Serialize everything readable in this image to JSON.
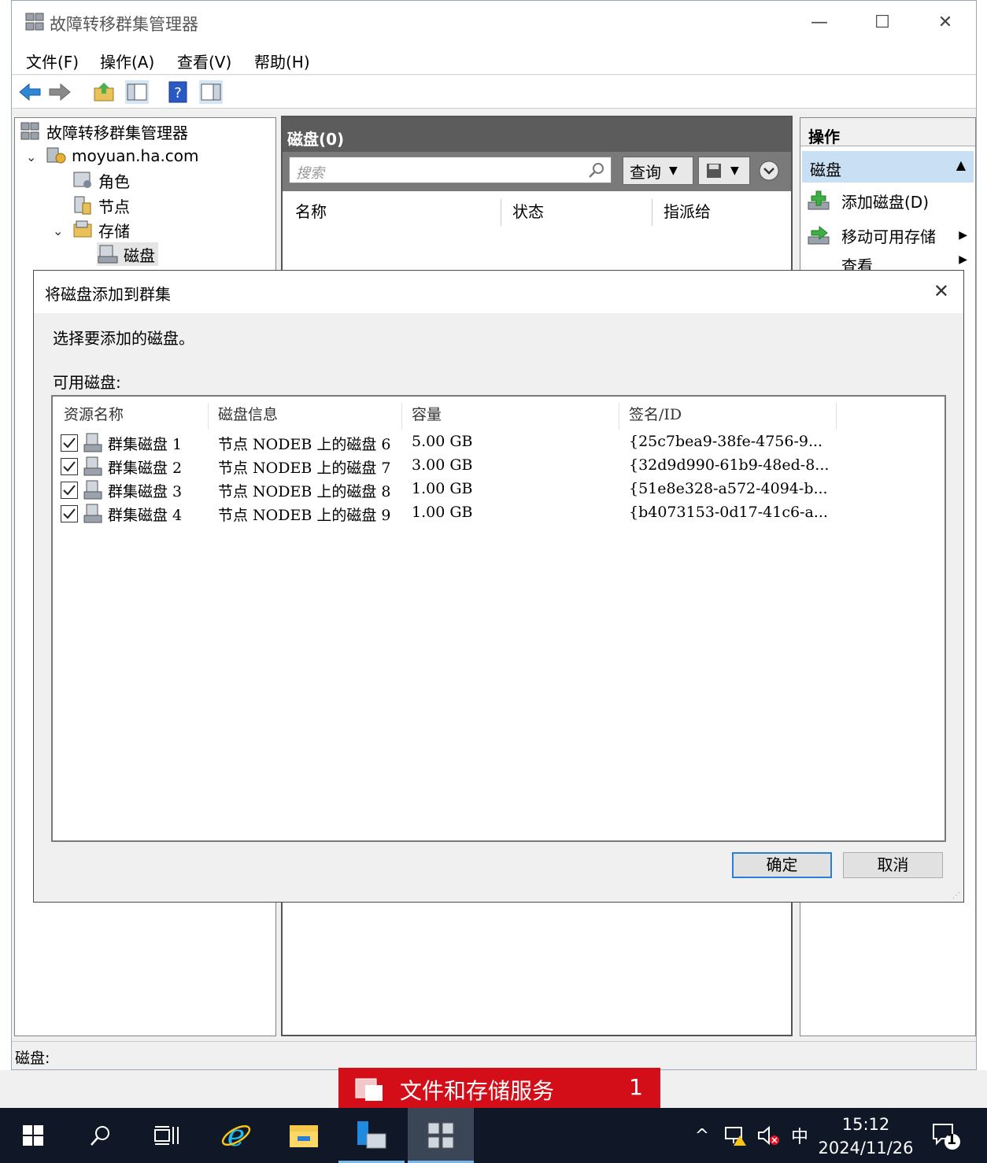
{
  "window": {
    "title": "故障转移群集管理器",
    "minimize": "—",
    "maximize": "☐",
    "close": "✕"
  },
  "menu": [
    "文件(F)",
    "操作(A)",
    "查看(V)",
    "帮助(H)"
  ],
  "tree": {
    "root": "故障转移群集管理器",
    "cluster": "moyuan.ha.com",
    "roles": "角色",
    "nodes": "节点",
    "storage": "存储",
    "disks": "磁盘"
  },
  "center": {
    "header": "磁盘(0)",
    "search_placeholder": "搜索",
    "query_label": "查询",
    "columns": [
      "名称",
      "状态",
      "指派给"
    ]
  },
  "actions": {
    "header": "操作",
    "section": "磁盘",
    "items": [
      "添加磁盘(D)",
      "移动可用存储",
      "查看"
    ]
  },
  "status_bar": "磁盘:",
  "dialog": {
    "title": "将磁盘添加到群集",
    "instruction": "选择要添加的磁盘。",
    "available_label": "可用磁盘:",
    "columns": [
      "资源名称",
      "磁盘信息",
      "容量",
      "签名/ID"
    ],
    "rows": [
      {
        "checked": true,
        "name": "群集磁盘 1",
        "info": "节点 NODEB 上的磁盘 6",
        "capacity": "5.00 GB",
        "id": "{25c7bea9-38fe-4756-9..."
      },
      {
        "checked": true,
        "name": "群集磁盘 2",
        "info": "节点 NODEB 上的磁盘 7",
        "capacity": "3.00 GB",
        "id": "{32d9d990-61b9-48ed-8..."
      },
      {
        "checked": true,
        "name": "群集磁盘 3",
        "info": "节点 NODEB 上的磁盘 8",
        "capacity": "1.00 GB",
        "id": "{51e8e328-a572-4094-b..."
      },
      {
        "checked": true,
        "name": "群集磁盘 4",
        "info": "节点 NODEB 上的磁盘 9",
        "capacity": "1.00 GB",
        "id": "{b4073153-0d17-41c6-a..."
      }
    ],
    "ok_label": "确定",
    "cancel_label": "取消"
  },
  "notification": {
    "text": "文件和存储服务",
    "count": "1"
  },
  "taskbar": {
    "ime": "中",
    "time": "15:12",
    "date": "2024/11/26",
    "notifications_count": "1",
    "accent": "#76b9ed"
  }
}
